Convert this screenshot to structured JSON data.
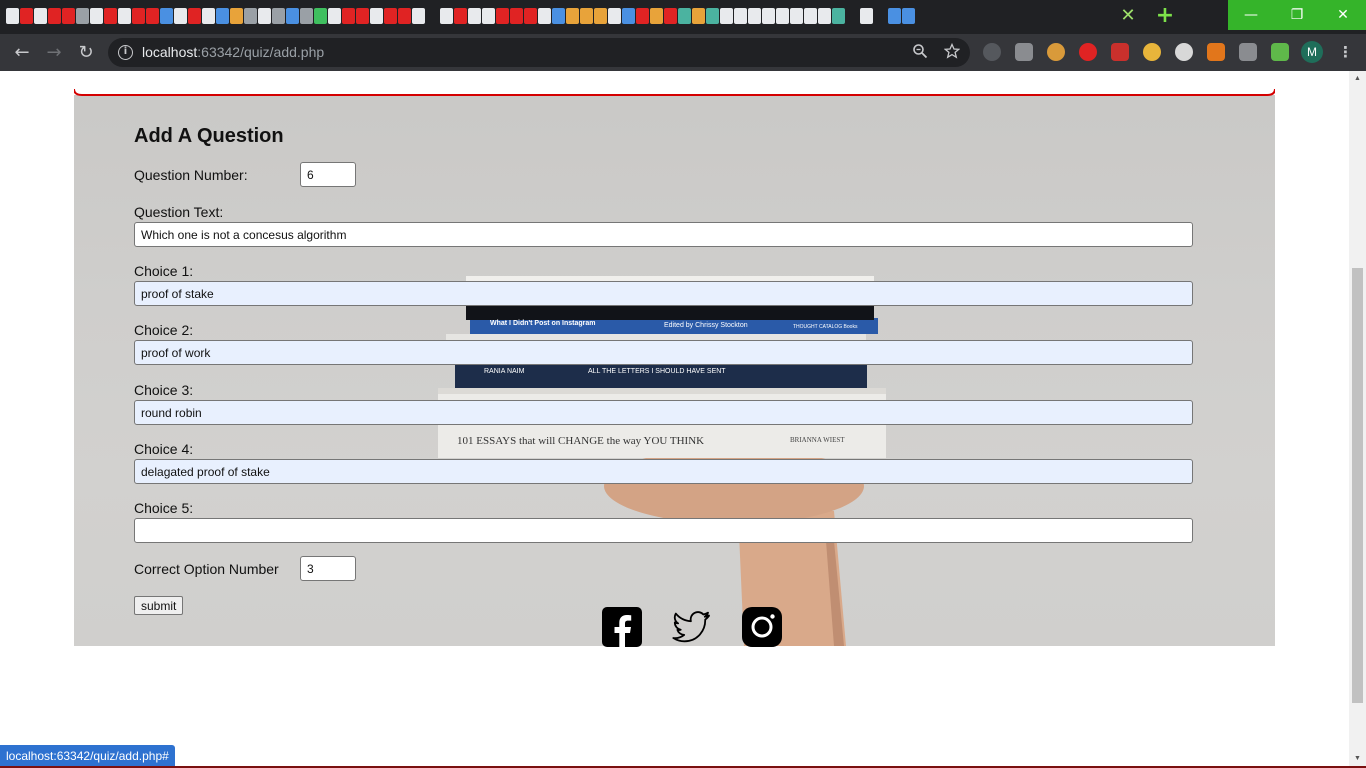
{
  "browser": {
    "url_host": "localhost",
    "url_rest": ":63342/quiz/add.php",
    "status_url": "localhost:63342/quiz/add.php#",
    "tab_close": "✕",
    "new_tab": "+",
    "window_minimize": "—",
    "window_restore": "❐",
    "window_close": "✕",
    "back": "←",
    "forward": "→",
    "reload": "↻",
    "profile_initial": "M",
    "menu": "⋮",
    "accent_color": "#35b42a"
  },
  "form": {
    "title": "Add A Question",
    "question_number_label": "Question Number:",
    "question_number_value": "6",
    "question_text_label": "Question Text:",
    "question_text_value": "Which one is not a concesus algorithm",
    "choices": [
      {
        "label": "Choice 1:",
        "value": "proof of stake"
      },
      {
        "label": "Choice 2:",
        "value": "proof of work"
      },
      {
        "label": "Choice 3:",
        "value": "round robin"
      },
      {
        "label": "Choice 4:",
        "value": "delagated proof of stake"
      },
      {
        "label": "Choice 5:",
        "value": ""
      }
    ],
    "correct_option_label": "Correct Option Number",
    "correct_option_value": "3",
    "submit_label": "submit"
  },
  "photo": {
    "book_1": "What I Didn't Post on Instagram",
    "book_1_editor": "Edited by Chrissy Stockton",
    "book_1_publisher": "THOUGHT CATALOG Books",
    "book_2_author": "RANIA NAIM",
    "book_2_title": "ALL THE LETTERS I SHOULD HAVE SENT",
    "book_3_title": "101 ESSAYS that will CHANGE the way YOU THINK",
    "book_3_author": "BRIANNA WIEST"
  },
  "social": [
    "facebook-icon",
    "twitter-icon",
    "instagram-icon"
  ]
}
